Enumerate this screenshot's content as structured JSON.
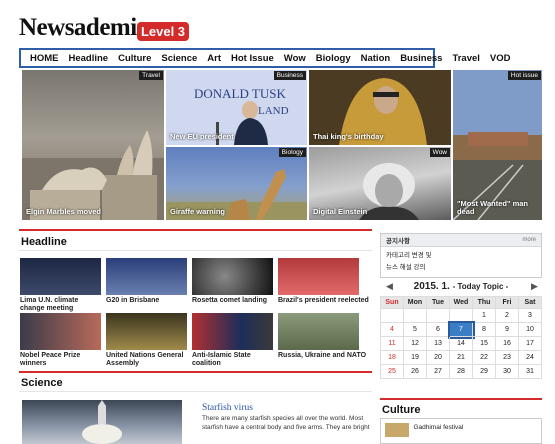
{
  "header": {
    "logo": "Newsademic",
    "level": "Level 3"
  },
  "nav": [
    "HOME",
    "Headline",
    "Culture",
    "Science",
    "Art",
    "Hot Issue",
    "Wow",
    "Biology",
    "Nation",
    "Business",
    "Travel",
    "VOD"
  ],
  "features": [
    {
      "tag": "Travel",
      "caption": "Elgin Marbles moved"
    },
    {
      "tag": "Business",
      "caption": "New EU president"
    },
    {
      "tag": "",
      "caption": "Thai king's birthday"
    },
    {
      "tag": "Hot issue",
      "caption": "\"Most Wanted\" man dead"
    },
    {
      "tag": "Biology",
      "caption": "Giraffe warning"
    },
    {
      "tag": "Wow",
      "caption": "Digital Einstein"
    }
  ],
  "feature_misc": {
    "eu_sign_text": "DONALD TUSK",
    "eu_sign_text2": "LAND"
  },
  "headline": {
    "title": "Headline",
    "items": [
      "Lima U.N. climate change meeting",
      "G20 in Brisbane",
      "Rosetta comet landing",
      "Brazil's president reelected",
      "Nobel Peace Prize winners",
      "United Nations General Assembly",
      "Anti-Islamic State coalition",
      "Russia, Ukraine and NATO"
    ]
  },
  "notice": {
    "title": "공지사항",
    "more": "more",
    "items": [
      "카테고리 변경 및",
      "뉴스 해설 강의"
    ]
  },
  "calendar": {
    "title": "2015. 1.",
    "subtitle": "- Today Topic -",
    "prev": "◀",
    "next": "▶",
    "days": [
      "Sun",
      "Mon",
      "Tue",
      "Wed",
      "Thu",
      "Fri",
      "Sat"
    ],
    "weeks": [
      [
        "",
        "",
        "",
        "",
        "1",
        "2",
        "3"
      ],
      [
        "4",
        "5",
        "6",
        "7",
        "8",
        "9",
        "10"
      ],
      [
        "11",
        "12",
        "13",
        "14",
        "15",
        "16",
        "17"
      ],
      [
        "18",
        "19",
        "20",
        "21",
        "22",
        "23",
        "24"
      ],
      [
        "25",
        "26",
        "27",
        "28",
        "29",
        "30",
        "31"
      ]
    ],
    "today": "7"
  },
  "science": {
    "title": "Science",
    "article_title": "Starfish virus",
    "article_body": "There are many starfish species all over the world. Most starfish have a central body and five arms. They are bright"
  },
  "culture": {
    "title": "Culture",
    "item": "Gadhimai festival"
  }
}
